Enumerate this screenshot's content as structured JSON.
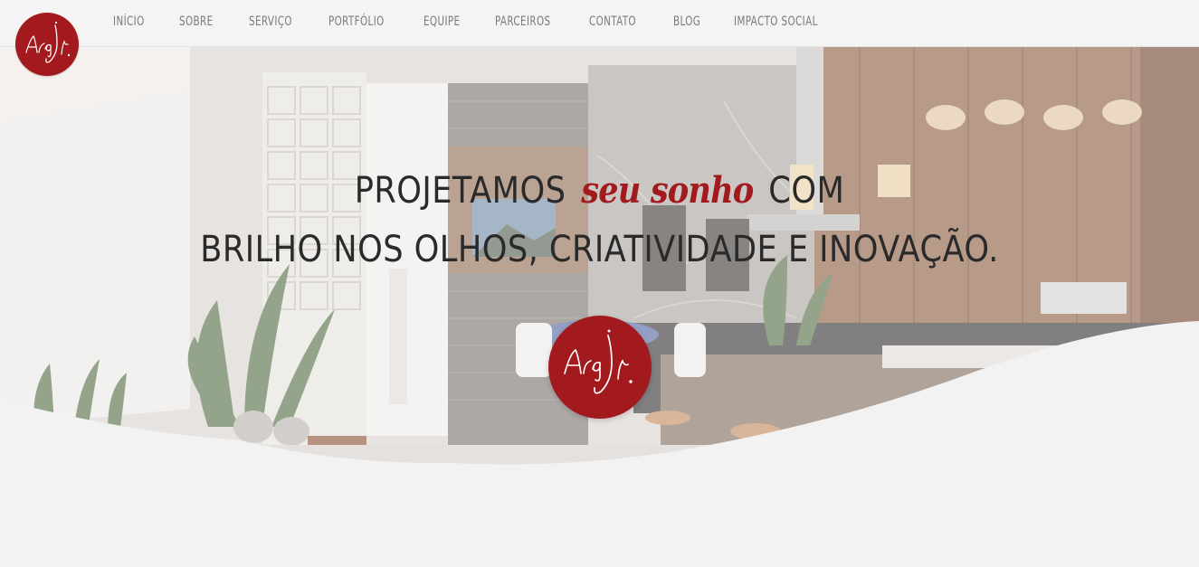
{
  "nav": {
    "items": [
      {
        "label": "INÍCIO"
      },
      {
        "label": "SOBRE"
      },
      {
        "label": "SERVIÇO"
      },
      {
        "label": "PORTFÓLIO"
      },
      {
        "label": "EQUIPE"
      },
      {
        "label": "PARCEIROS"
      },
      {
        "label": "CONTATO"
      },
      {
        "label": "BLOG"
      },
      {
        "label": "IMPACTO SOCIAL"
      }
    ]
  },
  "logo": {
    "text": "Arq Jr.",
    "color": "#a31a1e"
  },
  "hero": {
    "headline_before": "PROJETAMOS",
    "headline_accent": "seu sonho",
    "headline_after": "COM",
    "headline_line2": "BRILHO NOS OLHOS, CRIATIVIDADE E INOVAÇÃO."
  },
  "colors": {
    "brand": "#a31a1e",
    "background": "#f2f2f2",
    "nav_text": "#7a7a7a"
  }
}
